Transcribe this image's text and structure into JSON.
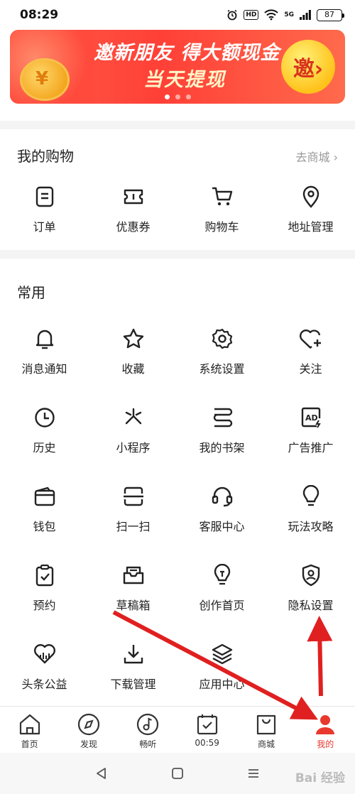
{
  "status_bar": {
    "time": "08:29",
    "hd": "HD",
    "network": "5G",
    "battery": "87"
  },
  "banner": {
    "line1": "邀新朋友 得大额现金",
    "line2": "当天提现",
    "badge": "邀›",
    "coin_symbol": "¥"
  },
  "shopping": {
    "title": "我的购物",
    "more": "去商城 ›",
    "items": [
      {
        "label": "订单",
        "icon": "order-icon"
      },
      {
        "label": "优惠券",
        "icon": "coupon-icon"
      },
      {
        "label": "购物车",
        "icon": "cart-icon"
      },
      {
        "label": "地址管理",
        "icon": "location-icon"
      }
    ]
  },
  "common": {
    "title": "常用",
    "items": [
      {
        "label": "消息通知",
        "icon": "bell-icon"
      },
      {
        "label": "收藏",
        "icon": "star-icon"
      },
      {
        "label": "系统设置",
        "icon": "gear-icon"
      },
      {
        "label": "关注",
        "icon": "heart-plus-icon"
      },
      {
        "label": "历史",
        "icon": "clock-icon"
      },
      {
        "label": "小程序",
        "icon": "mini-program-icon"
      },
      {
        "label": "我的书架",
        "icon": "bookshelf-icon"
      },
      {
        "label": "广告推广",
        "icon": "ad-icon"
      },
      {
        "label": "钱包",
        "icon": "wallet-icon"
      },
      {
        "label": "扫一扫",
        "icon": "scan-icon"
      },
      {
        "label": "客服中心",
        "icon": "headset-icon"
      },
      {
        "label": "玩法攻略",
        "icon": "bulb-icon"
      },
      {
        "label": "预约",
        "icon": "clipboard-check-icon"
      },
      {
        "label": "草稿箱",
        "icon": "draft-box-icon"
      },
      {
        "label": "创作首页",
        "icon": "create-bulb-icon"
      },
      {
        "label": "隐私设置",
        "icon": "privacy-shield-icon"
      },
      {
        "label": "头条公益",
        "icon": "charity-icon"
      },
      {
        "label": "下载管理",
        "icon": "download-icon"
      },
      {
        "label": "应用中心",
        "icon": "layers-icon"
      }
    ]
  },
  "bottom_nav": [
    {
      "label": "首页",
      "icon": "home-icon"
    },
    {
      "label": "发现",
      "icon": "compass-icon"
    },
    {
      "label": "畅听",
      "icon": "music-disc-icon"
    },
    {
      "label": "00:59",
      "icon": "calendar-check-icon"
    },
    {
      "label": "商城",
      "icon": "bag-icon"
    },
    {
      "label": "我的",
      "icon": "user-icon",
      "active": true
    }
  ],
  "watermark": "Bai 经验",
  "colors": {
    "accent": "#e8392f",
    "banner": "#ff4037",
    "arrow": "#e02020"
  }
}
